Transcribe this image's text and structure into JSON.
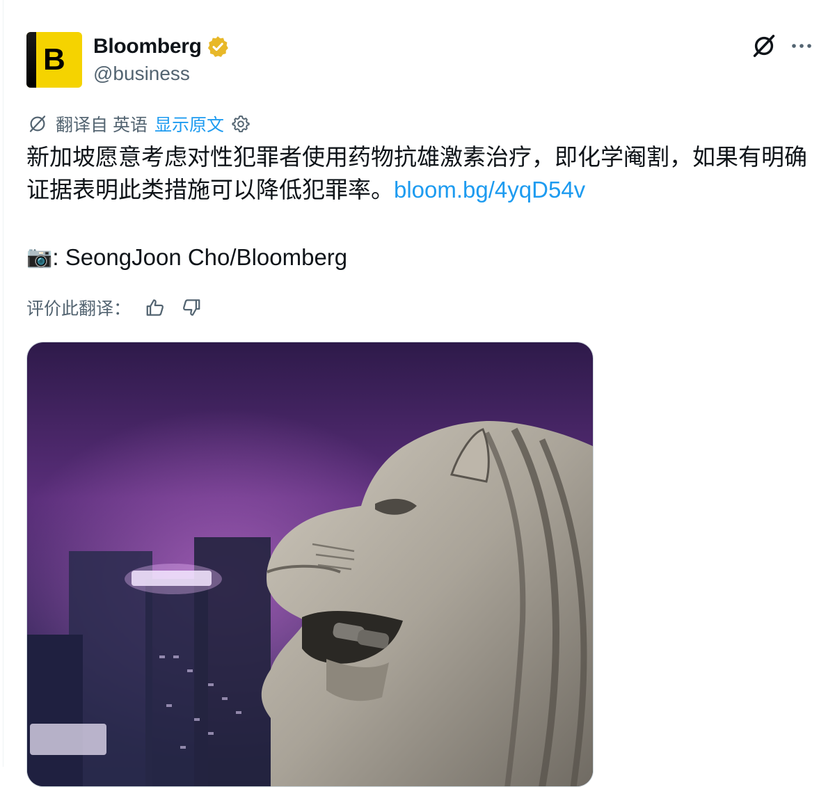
{
  "author": {
    "display_name": "Bloomberg",
    "handle": "@business",
    "avatar_letter": "B",
    "verified_icon": "verified-badge-icon"
  },
  "top_actions": {
    "grok_icon": "grok-slash-icon",
    "more_icon": "more-ellipsis-icon"
  },
  "translation": {
    "icon": "translate-icon",
    "label": "翻译自 英语",
    "show_original": "显示原文",
    "settings_icon": "gear-icon"
  },
  "tweet": {
    "text": "新加坡愿意考虑对性犯罪者使用药物抗雄激素治疗，即化学阉割，如果有明确证据表明此类措施可以降低犯罪率。",
    "link": "bloom.bg/4yqD54v",
    "credit_emoji": "📷",
    "credit_text": ": SeongJoon Cho/Bloomberg"
  },
  "rate": {
    "label": "评价此翻译：",
    "thumbs_up_icon": "thumbs-up-icon",
    "thumbs_down_icon": "thumbs-down-icon"
  },
  "colors": {
    "link": "#1d9bf0",
    "secondary_text": "#536471",
    "brand_yellow": "#f5d300",
    "verified_gold": "#e8b829"
  }
}
